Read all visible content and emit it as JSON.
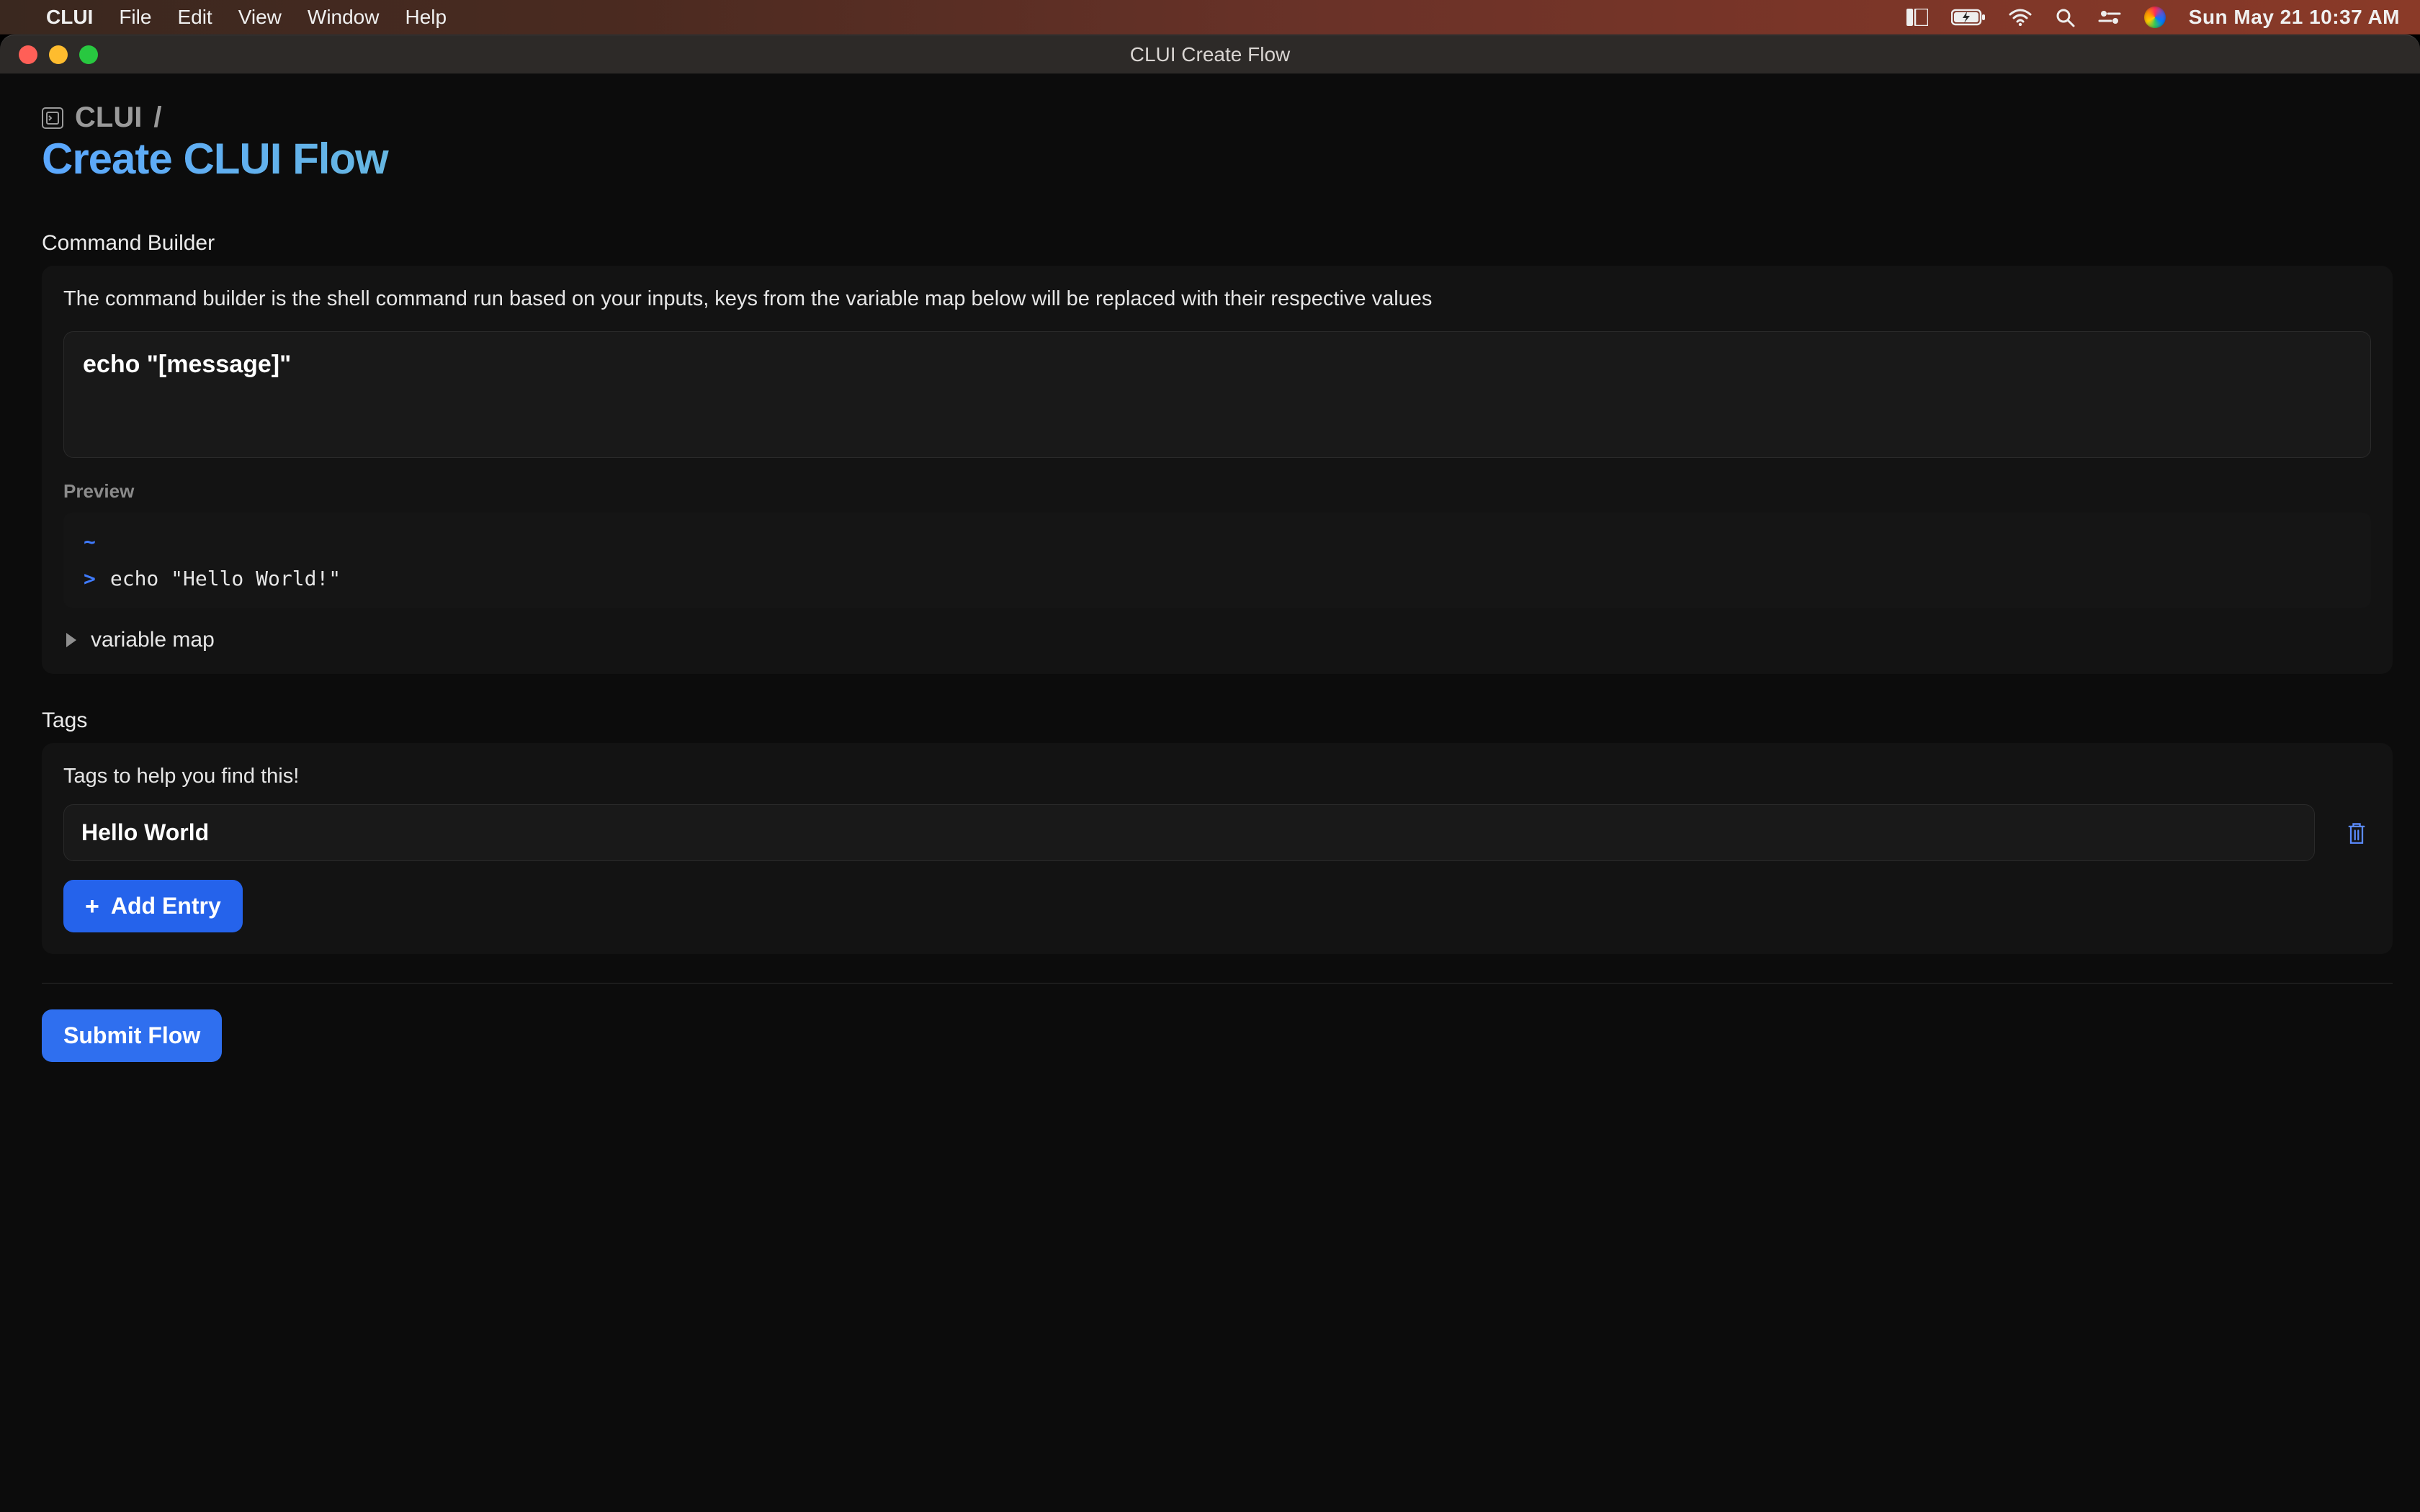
{
  "menubar": {
    "app_name": "CLUI",
    "menus": [
      "File",
      "Edit",
      "View",
      "Window",
      "Help"
    ],
    "clock": "Sun May 21  10:37 AM"
  },
  "titlebar": {
    "title": "CLUI Create Flow"
  },
  "breadcrumb": {
    "root": "CLUI",
    "sep": "/"
  },
  "page": {
    "title": "Create CLUI Flow"
  },
  "command_builder": {
    "label": "Command Builder",
    "description": "The command builder is the shell command run based on your inputs, keys from the variable map below will be replaced with their respective values",
    "value": "echo \"[message]\"",
    "preview_label": "Preview",
    "preview_path": "~",
    "preview_prompt": ">",
    "preview_command": "echo \"Hello World!\"",
    "variable_map_label": "variable map"
  },
  "tags": {
    "label": "Tags",
    "description": "Tags to help you find this!",
    "entries": [
      "Hello World"
    ],
    "add_entry_label": "Add Entry"
  },
  "actions": {
    "submit_label": "Submit Flow"
  },
  "colors": {
    "accent": "#2563eb",
    "link": "#3f7bff"
  }
}
